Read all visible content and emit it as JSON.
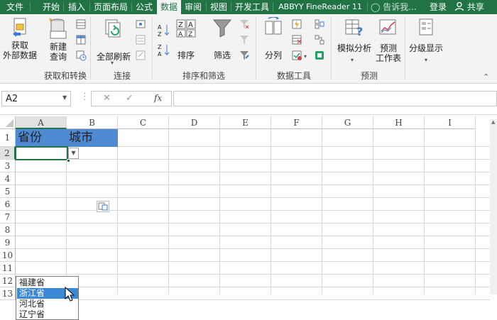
{
  "tabs": [
    {
      "label": "文件",
      "active": false
    },
    {
      "label": "开始",
      "active": false
    },
    {
      "label": "插入",
      "active": false
    },
    {
      "label": "页面布局",
      "active": false
    },
    {
      "label": "公式",
      "active": false
    },
    {
      "label": "数据",
      "active": true
    },
    {
      "label": "审阅",
      "active": false
    },
    {
      "label": "视图",
      "active": false
    },
    {
      "label": "开发工具",
      "active": false
    },
    {
      "label": "ABBYY FineReader 11",
      "active": false
    }
  ],
  "tell_me": "告诉我...",
  "login": "登录",
  "share": "共享",
  "ribbon": {
    "get_external": {
      "line1": "获取",
      "line2": "外部数据"
    },
    "new_query": {
      "line1": "新建",
      "line2": "查询"
    },
    "group_get_transform": "获取和转换",
    "refresh_all": "全部刷新",
    "group_connections": "连接",
    "sort": "排序",
    "filter": "筛选",
    "group_sort_filter": "排序和筛选",
    "text_to_columns": "分列",
    "group_data_tools": "数据工具",
    "what_if": "模拟分析",
    "forecast": {
      "line1": "预测",
      "line2": "工作表"
    },
    "group_forecast": "预测",
    "outline": "分级显示",
    "sort_az": "A↓Z",
    "sort_label_az": "A\nZ"
  },
  "formula_bar": {
    "name_box": "A2",
    "cancel": "✕",
    "enter": "✓",
    "fx": "fx",
    "value": ""
  },
  "columns": [
    "A",
    "B",
    "C",
    "D",
    "E",
    "F",
    "G",
    "H",
    "I"
  ],
  "rows": [
    "1",
    "2",
    "3",
    "4",
    "5",
    "6",
    "7",
    "8",
    "9",
    "10",
    "11",
    "12",
    "13"
  ],
  "cells": {
    "A1": "省份",
    "B1": "城市"
  },
  "header_fill": "#4e8ad4",
  "accent": "#217346",
  "dropdown": {
    "items": [
      "福建省",
      "浙江省",
      "河北省",
      "辽宁省"
    ],
    "selected_index": 1
  }
}
